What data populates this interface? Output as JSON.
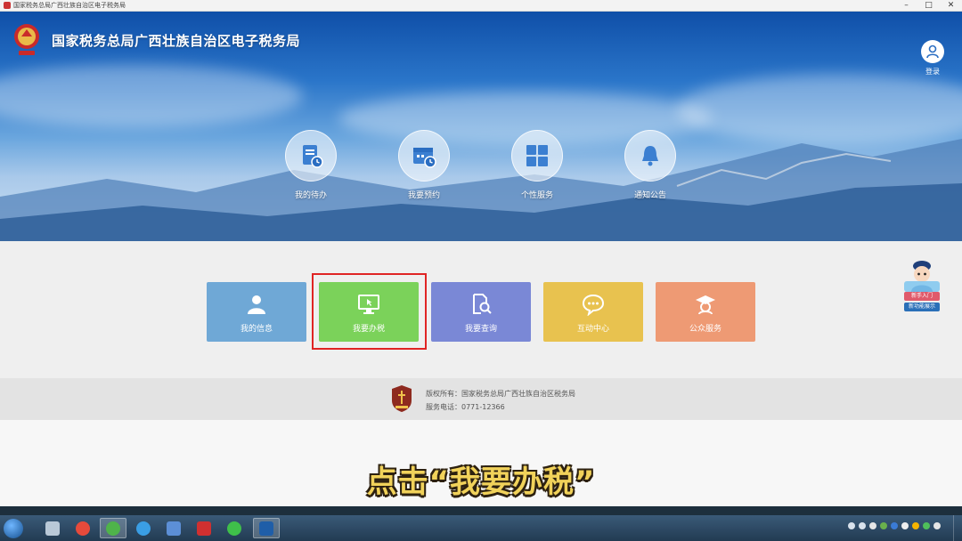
{
  "window": {
    "title": "国家税务总局广西壮族自治区电子税务局",
    "min": "–",
    "max": "□",
    "close": "✕"
  },
  "header": {
    "site_title": "国家税务总局广西壮族自治区电子税务局",
    "login_label": "登录"
  },
  "quick_entries": [
    {
      "label": "我的待办",
      "icon": "todo-document-icon"
    },
    {
      "label": "我要预约",
      "icon": "calendar-clock-icon"
    },
    {
      "label": "个性服务",
      "icon": "grid-icon"
    },
    {
      "label": "通知公告",
      "icon": "bell-icon"
    }
  ],
  "tiles": [
    {
      "label": "我的信息",
      "icon": "user-icon",
      "color": "#6fa8d6"
    },
    {
      "label": "我要办税",
      "icon": "monitor-cursor-icon",
      "color": "#7bd25a"
    },
    {
      "label": "我要查询",
      "icon": "search-document-icon",
      "color": "#7a88d6"
    },
    {
      "label": "互动中心",
      "icon": "chat-icon",
      "color": "#e8c24f"
    },
    {
      "label": "公众服务",
      "icon": "graduate-icon",
      "color": "#ee9a74"
    }
  ],
  "assistant": {
    "label_top": "新手入门",
    "label_bottom": "新功能展示"
  },
  "footer": {
    "copyright": "版权所有：国家税务总局广西壮族自治区税务局",
    "phone": "服务电话：0771-12366"
  },
  "caption": "点击“我要办税”",
  "colors": {
    "highlight_border": "#e02424",
    "caption_fill": "#f1d25a"
  }
}
